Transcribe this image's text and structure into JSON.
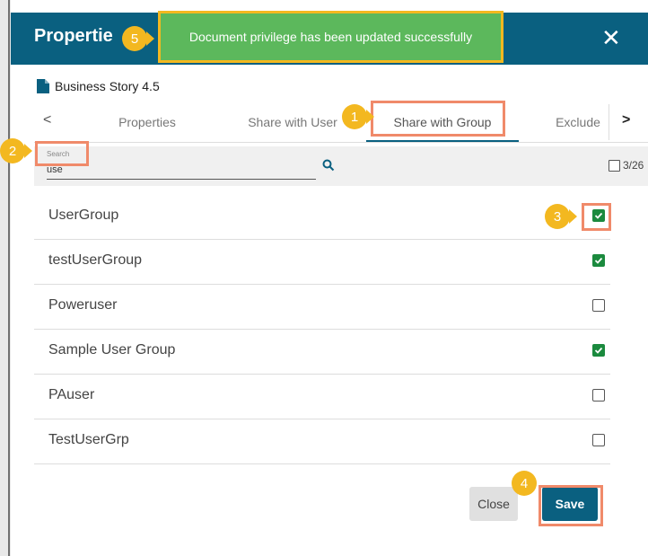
{
  "dialog": {
    "title": "Propertie",
    "close_symbol": "✕"
  },
  "document": {
    "name": "Business Story 4.5",
    "icon": "document-icon"
  },
  "tabs": {
    "prev_symbol": "<",
    "next_symbol": ">",
    "items": [
      {
        "label": "Properties"
      },
      {
        "label": "Share with User"
      },
      {
        "label": "Share with Group",
        "active": true
      },
      {
        "label": "Exclude"
      }
    ]
  },
  "search": {
    "label": "Search",
    "value": "use"
  },
  "selection": {
    "count_text": "3/26"
  },
  "groups": [
    {
      "name": "UserGroup",
      "checked": true
    },
    {
      "name": "testUserGroup",
      "checked": true
    },
    {
      "name": "Poweruser",
      "checked": false
    },
    {
      "name": "Sample User Group",
      "checked": true
    },
    {
      "name": "PAuser",
      "checked": false
    },
    {
      "name": "TestUserGrp",
      "checked": false
    }
  ],
  "buttons": {
    "close_label": "Close",
    "save_label": "Save"
  },
  "toast": {
    "message": "Document privilege has been updated successfully"
  },
  "step_markers": [
    "1",
    "2",
    "3",
    "4",
    "5"
  ],
  "colors": {
    "header": "#0a6080",
    "checked": "#1b8a3e",
    "marker": "#f3b820",
    "highlight": "#f08a6a",
    "toast": "#5cb85c"
  }
}
